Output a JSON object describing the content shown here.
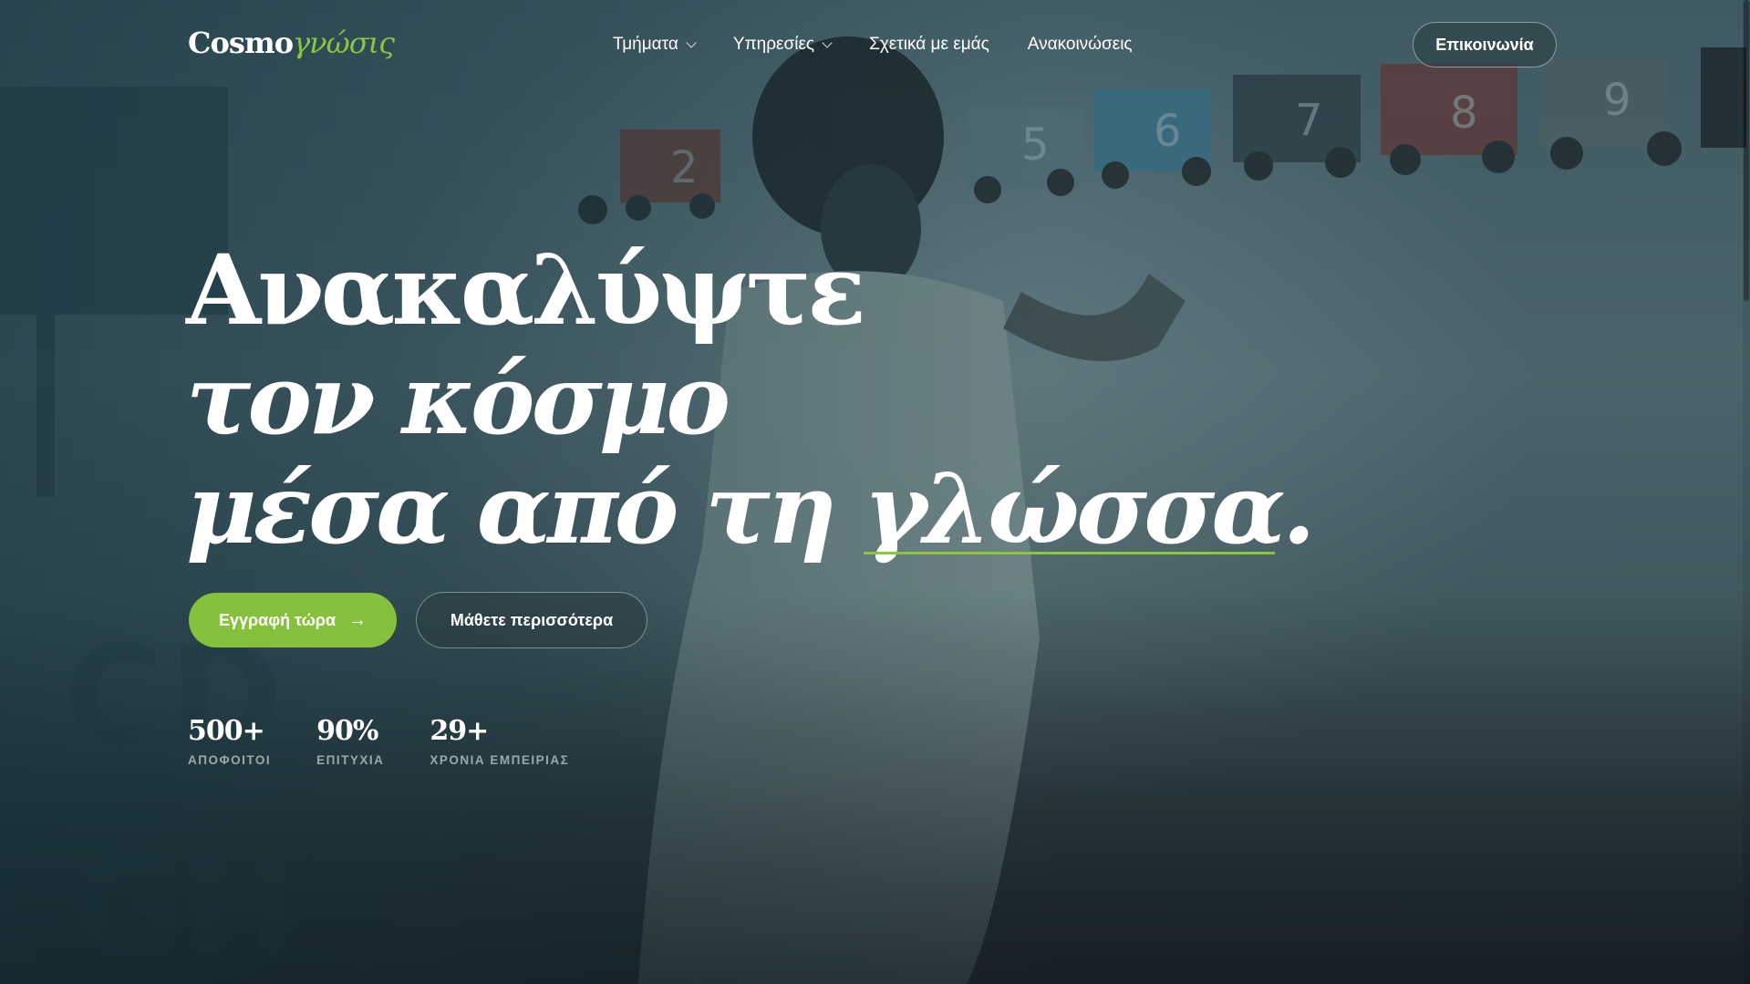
{
  "brand": {
    "logo_main": "Cosmo",
    "logo_accent": "γνώσις"
  },
  "nav": {
    "items": [
      {
        "label": "Τμήματα",
        "has_dropdown": true
      },
      {
        "label": "Υπηρεσίες",
        "has_dropdown": true
      },
      {
        "label": "Σχετικά με εμάς",
        "has_dropdown": false
      },
      {
        "label": "Ανακοινώσεις",
        "has_dropdown": false
      }
    ],
    "contact_label": "Επικοινωνία"
  },
  "hero": {
    "line1": "Ανακαλύψτε",
    "line2": "τον κόσμο",
    "line3_prefix": "μέσα από τη ",
    "line3_highlight": "γλώσσα",
    "line3_suffix": ".",
    "primary_cta": "Εγγραφή τώρα",
    "secondary_cta": "Μάθετε περισσότερα"
  },
  "stats": [
    {
      "value": "500+",
      "label": "ΑΠΟΦΟΙΤΟΙ"
    },
    {
      "value": "90%",
      "label": "ΕΠΙΤΥΧΙΑ"
    },
    {
      "value": "29+",
      "label": "ΧΡΟΝΙΑ ΕΜΠΕΙΡΙΑΣ"
    }
  ],
  "background": {
    "train_numbers": [
      "2",
      "5",
      "6",
      "7",
      "8",
      "9"
    ],
    "wall_letters": [
      "C",
      "D",
      "G",
      "H"
    ]
  },
  "colors": {
    "accent": "#8cc63f",
    "overlay": "#3f5a63",
    "text": "#ffffff",
    "muted": "#9aa9ad"
  },
  "icons": {
    "dropdown": "chevron-down-icon",
    "cta_arrow": "arrow-right-icon"
  }
}
